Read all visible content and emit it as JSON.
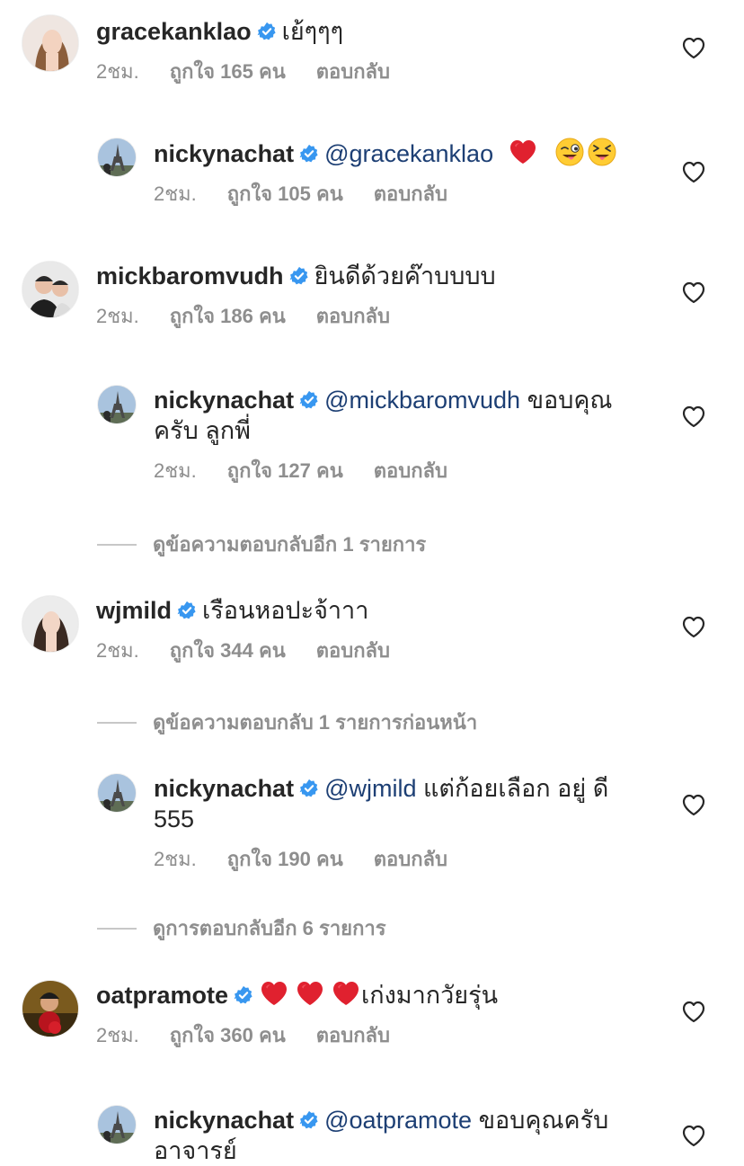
{
  "colors": {
    "text": "#262626",
    "secondary": "#8e8e8e",
    "mention": "#1d3f74",
    "verified": "#3897f0",
    "heart": "#ed4956"
  },
  "comments": [
    {
      "username": "gracekanklao",
      "verified": true,
      "text": "เย้ๆๆๆ",
      "time": "2ชม.",
      "likes": "ถูกใจ 165 คน",
      "reply_label": "ตอบกลับ",
      "reply": {
        "username": "nickynachat",
        "verified": true,
        "mention": "@gracekanklao",
        "text": "",
        "emojis": [
          "red-heart",
          "winking-face-with-tongue",
          "squinting-face-with-tongue"
        ],
        "time": "2ชม.",
        "likes": "ถูกใจ 105 คน",
        "reply_label": "ตอบกลับ"
      }
    },
    {
      "username": "mickbaromvudh",
      "verified": true,
      "text": "ยินดีด้วยค๊าบบบบ",
      "time": "2ชม.",
      "likes": "ถูกใจ 186 คน",
      "reply_label": "ตอบกลับ",
      "reply": {
        "username": "nickynachat",
        "verified": true,
        "mention": "@mickbaromvudh",
        "text": " ขอบคุณครับ ลูกพี่",
        "time": "2ชม.",
        "likes": "ถูกใจ 127 คน",
        "reply_label": "ตอบกลับ"
      },
      "view_more": "ดูข้อความตอบกลับอีก 1 รายการ"
    },
    {
      "username": "wjmild",
      "verified": true,
      "text": "เรือนหอปะจ้าาา",
      "time": "2ชม.",
      "likes": "ถูกใจ 344 คน",
      "reply_label": "ตอบกลับ",
      "view_previous": "ดูข้อความตอบกลับ 1 รายการก่อนหน้า",
      "reply": {
        "username": "nickynachat",
        "verified": true,
        "mention": "@wjmild",
        "text": "  แต่ก้อยเลือก อยู่ ดี 555",
        "time": "2ชม.",
        "likes": "ถูกใจ 190 คน",
        "reply_label": "ตอบกลับ"
      },
      "view_more": "ดูการตอบกลับอีก 6 รายการ"
    },
    {
      "username": "oatpramote",
      "verified": true,
      "hearts": 3,
      "text": "เก่งมากวัยรุ่น",
      "time": "2ชม.",
      "likes": "ถูกใจ 360 คน",
      "reply_label": "ตอบกลับ",
      "reply": {
        "username": "nickynachat",
        "verified": true,
        "mention": "@oatpramote",
        "text": "  ขอบคุณครับ อาจารย์"
      }
    }
  ]
}
